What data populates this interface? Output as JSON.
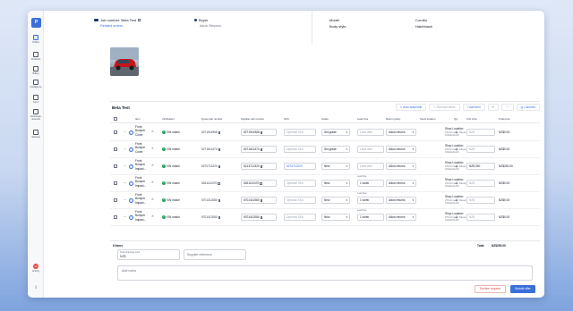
{
  "sidebar": {
    "logo": "P",
    "items": [
      {
        "label": "Orders",
        "active": true
      },
      {
        "label": "Products"
      },
      {
        "label": "Billing"
      },
      {
        "label": "Intelligence"
      },
      {
        "label": "Sync"
      },
      {
        "label": "Exchange requests"
      },
      {
        "label": "Settings"
      }
    ],
    "activity_label": "Activity",
    "activity_count": "10"
  },
  "header": {
    "job_number": "Job number: Beta Test",
    "related_orders": "Related orders",
    "buyer_label": "Buyer",
    "buyer_name": "Aaron Simpson",
    "model_label": "Model",
    "model_value": "Corolla",
    "body_style_label": "Body style",
    "body_style_value": "Hatchback"
  },
  "card": {
    "title": "Beta Test",
    "toolbar": {
      "auto_assemble": "Auto assemble",
      "remove_items": "Remove items",
      "add_item": "+ Add item",
      "undo": "↶",
      "more": "···",
      "columns": "Columns"
    },
    "columns": [
      "Item",
      "Verification",
      "Quote part number",
      "Supplier part number",
      "SKU",
      "Grade",
      "Lead time",
      "Return policy",
      "Stock location",
      "Qty",
      "Unit price",
      "Total price"
    ],
    "verification_label": "VIN match",
    "placeholders": {
      "sku": "Optional SKU",
      "lead_time": "Lead time",
      "unit_price": "NZ$"
    },
    "rows": [
      {
        "desc": [
          "Front",
          "Bumper",
          "Cover"
        ],
        "qpn": "5271914968",
        "spn": "5271914968",
        "sku": "",
        "grade": "Set grade",
        "lead": "",
        "lead_label": "",
        "return": "Allow returns",
        "loc1": "Shop Location",
        "loc2": "270 Armagh Street,",
        "loc3": "Christchurch",
        "qty": "1",
        "unit": "",
        "total": "NZ$0.00"
      },
      {
        "desc": [
          "Front",
          "Bumper",
          "Cover"
        ],
        "qpn": "5271612470",
        "spn": "5271612470",
        "sku": "",
        "grade": "Set grade",
        "lead": "",
        "lead_label": "",
        "return": "Allow returns",
        "loc1": "Shop Location",
        "loc2": "270 Armagh Street,",
        "loc3": "Christchurch",
        "qty": "1",
        "unit": "",
        "total": "NZ$0.00"
      },
      {
        "desc": [
          "Front",
          "Bumper",
          "Impact..."
        ],
        "qpn": "5270712220",
        "spn": "5213712320",
        "sku": "5270712220",
        "grade": "New",
        "lead": "",
        "lead_label": "",
        "return": "Allow returns",
        "loc1": "Shop Location",
        "loc2": "270 Armagh Street,",
        "loc3": "Christchurch",
        "qty": "1",
        "unit": "NZ$ 250",
        "total": "NZ$250.00"
      },
      {
        "desc": [
          "Front",
          "Bumper",
          "Impact..."
        ],
        "qpn": "5261112470",
        "spn": "5261112470",
        "sku": "",
        "grade": "New",
        "lead": "1 week",
        "lead_label": "Lead time",
        "return": "Allow returns",
        "loc1": "Shop Location",
        "loc2": "270 Armagh Street,",
        "loc3": "Christchurch",
        "qty": "1",
        "unit": "",
        "total": "NZ$0.00"
      },
      {
        "desc": [
          "Front",
          "Bumper",
          "Impact..."
        ],
        "qpn": "5701312080",
        "spn": "5701312080",
        "sku": "",
        "grade": "New",
        "lead": "1 week",
        "lead_label": "Lead time",
        "return": "Allow returns",
        "loc1": "Shop Location",
        "loc2": "270 Armagh Street,",
        "loc3": "Christchurch",
        "qty": "1",
        "unit": "",
        "total": "NZ$0.00"
      },
      {
        "desc": [
          "Front",
          "Bumper",
          "Impact..."
        ],
        "qpn": "5701412080",
        "spn": "5701412080",
        "sku": "",
        "grade": "New",
        "lead": "1 week",
        "lead_label": "Lead time",
        "return": "Allow returns",
        "loc1": "Shop Location",
        "loc2": "270 Armagh Street,",
        "loc3": "Christchurch",
        "qty": "1",
        "unit": "",
        "total": "NZ$0.00"
      }
    ],
    "items_count": "6 Items",
    "total_label": "Total",
    "total_value": "NZ$250.00",
    "total_shipping_label": "Total shipping price",
    "total_shipping_value": "NZ$",
    "supplier_reference_placeholder": "Supplier reference",
    "add_notes_placeholder": "Add notes",
    "decline_button": "Decline request",
    "submit_button": "Submit offer"
  },
  "colors": {
    "accent": "#3b6fd8",
    "success": "#22a45d",
    "danger": "#d64545"
  }
}
